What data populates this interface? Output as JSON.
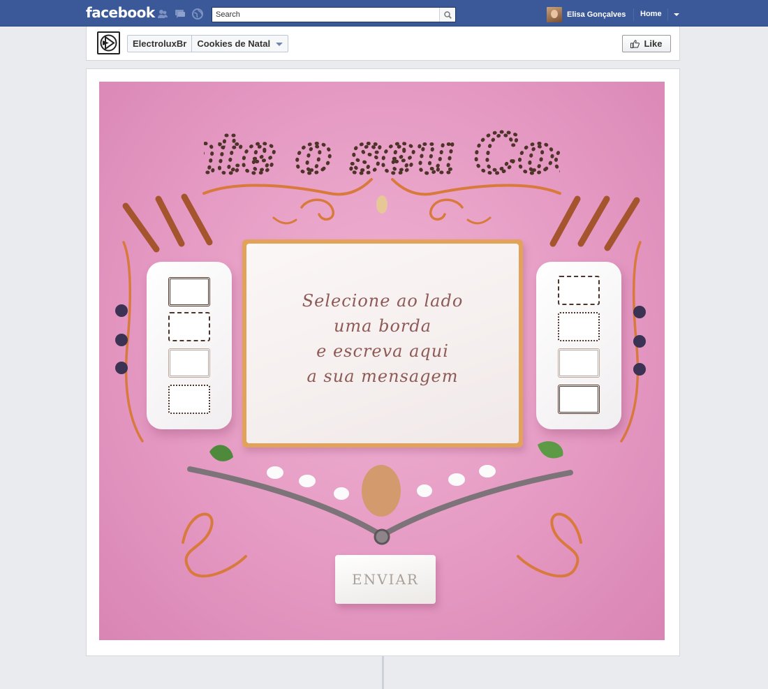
{
  "topbar": {
    "logo": "facebook",
    "search_placeholder": "Search",
    "user_name": "Elisa Gonçalves",
    "home_label": "Home",
    "icons": [
      "friend-requests-icon",
      "messages-icon",
      "notifications-icon",
      "search-icon",
      "chevron-down-icon"
    ]
  },
  "page": {
    "breadcrumb": [
      "ElectroluxBr",
      "Cookies de Natal"
    ],
    "like_label": "Like"
  },
  "app": {
    "title_text": "Monte o seu Cookie",
    "message_placeholder": "Selecione ao lado\numa borda\ne escreva aqui\na sua mensagem",
    "submit_label": "ENVIAR"
  },
  "colors": {
    "brand": "#3b5998",
    "canvas_pink": "#e59ac3",
    "chocolate": "#4d3328",
    "caramel": "#d97a3d"
  }
}
